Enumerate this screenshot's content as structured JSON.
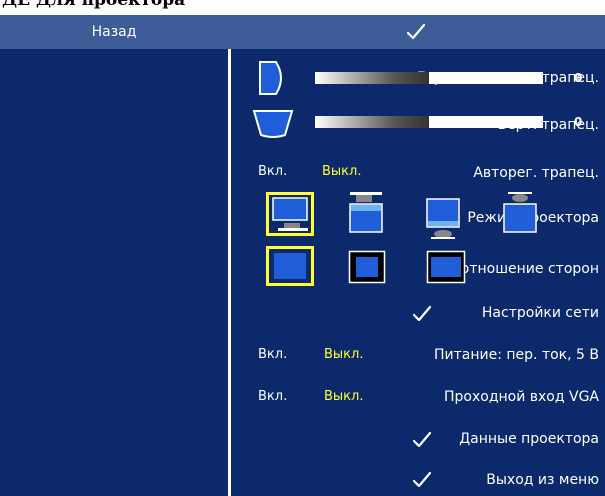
{
  "caption": "ДЕ Для проектора",
  "header": {
    "label": "Назад"
  },
  "rows": {
    "h_keystone": {
      "label": "Горизонтальная трапец.",
      "value": "0"
    },
    "v_keystone": {
      "label": "Верт. трапец.",
      "value": "0"
    },
    "auto_keystone": {
      "label": "Авторег. трапец.",
      "on": "Вкл.",
      "off": "Выкл."
    },
    "projector_mode": {
      "label": "Режим проектора"
    },
    "aspect_ratio": {
      "label": "Соотношение сторон"
    },
    "network": {
      "label": "Настройки сети"
    },
    "dc_power": {
      "label": "Питание: пер. ток, 5 В",
      "on": "Вкл.",
      "off": "Выкл."
    },
    "vga_through": {
      "label": "Проходной вход VGA",
      "on": "Вкл.",
      "off": "Выкл."
    },
    "projector_info": {
      "label": "Данные проектора"
    },
    "exit": {
      "label": "Выход из меню"
    }
  },
  "colors": {
    "background": "#0c2a6b",
    "header": "#3d5c98",
    "selected": "#ffff33",
    "text": "#ffffff"
  },
  "icons": {
    "check": "check-icon",
    "modes": [
      "front-desk-icon",
      "front-ceiling-icon",
      "rear-desk-icon",
      "rear-ceiling-icon"
    ],
    "aspects": [
      "aspect-original-icon",
      "aspect-4-3-icon",
      "aspect-wide-icon"
    ]
  }
}
